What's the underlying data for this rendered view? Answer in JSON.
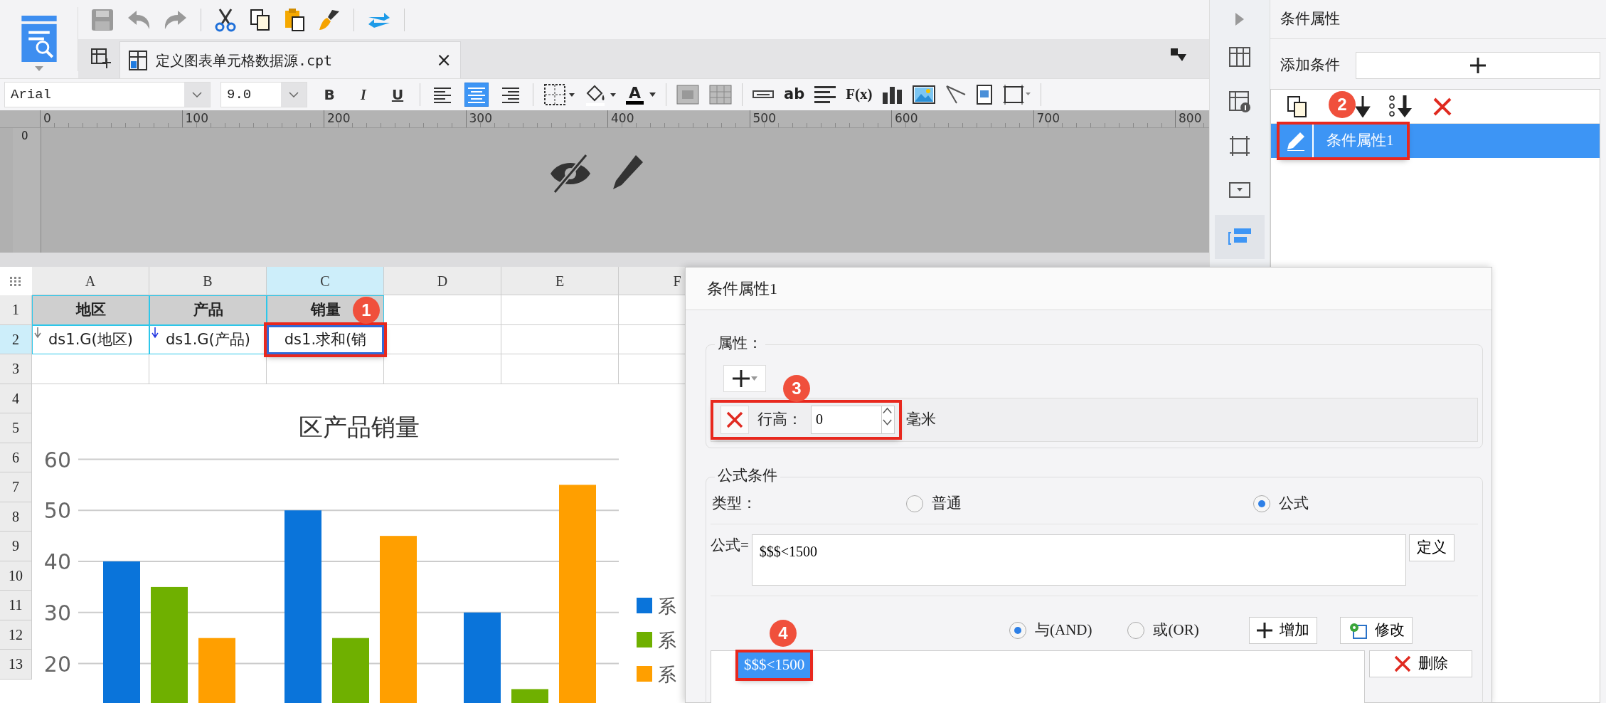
{
  "toolbar": {
    "tab": {
      "title": "定义图表单元格数据源.cpt",
      "close": "×"
    }
  },
  "format_bar": {
    "font": "Arial",
    "font_size": "9.0",
    "style_buttons": [
      "B",
      "I",
      "U"
    ],
    "align_buttons": [
      {
        "kind": "left",
        "selected": false
      },
      {
        "kind": "center",
        "selected": true
      },
      {
        "kind": "right",
        "selected": false
      }
    ],
    "font_color_label": "A",
    "text_field_label": "ab",
    "formula_label": "F(x)"
  },
  "ruler": {
    "ticks": [
      "0",
      "100",
      "200",
      "300",
      "400",
      "500",
      "600",
      "700",
      "800"
    ],
    "vertical_tick": "0"
  },
  "sheet": {
    "columns": [
      {
        "label": "A",
        "selected": false
      },
      {
        "label": "B",
        "selected": false
      },
      {
        "label": "C",
        "selected": true
      },
      {
        "label": "D",
        "selected": false
      },
      {
        "label": "E",
        "selected": false
      },
      {
        "label": "F",
        "selected": false
      }
    ],
    "rows": [
      {
        "number": "1",
        "selected": false,
        "cells": [
          {
            "text": "地区",
            "kind": "header",
            "outlined": false
          },
          {
            "text": "产品",
            "kind": "header",
            "outlined": false
          },
          {
            "text": "销量",
            "kind": "header",
            "outlined": false
          }
        ]
      },
      {
        "number": "2",
        "selected": true,
        "cells": [
          {
            "text": "ds1.G(地区)",
            "kind": "group",
            "outlined": false
          },
          {
            "text": "ds1.G(产品)",
            "kind": "group",
            "outlined": false
          },
          {
            "text": "ds1.求和(销",
            "kind": "sum",
            "outlined": true
          }
        ]
      },
      {
        "number": "3",
        "selected": false
      },
      {
        "number": "4",
        "selected": false
      },
      {
        "number": "5",
        "selected": false
      },
      {
        "number": "6",
        "selected": false
      },
      {
        "number": "7",
        "selected": false
      },
      {
        "number": "8",
        "selected": false
      },
      {
        "number": "9",
        "selected": false
      },
      {
        "number": "10",
        "selected": false
      },
      {
        "number": "11",
        "selected": false
      },
      {
        "number": "12",
        "selected": false
      },
      {
        "number": "13",
        "selected": false
      }
    ],
    "chart": {
      "chart_data": {
        "type": "bar",
        "title": "区产品销量",
        "yticks": [
          20,
          30,
          40,
          50,
          60
        ],
        "ylim": [
          12,
          60
        ],
        "grid": true,
        "series": [
          {
            "name": "系",
            "color": "#0a74da",
            "values": [
              40,
              50,
              30
            ]
          },
          {
            "name": "系",
            "color": "#6fb000",
            "values": [
              35,
              25,
              15
            ]
          },
          {
            "name": "系",
            "color": "#ff9f00",
            "values": [
              25,
              45,
              55
            ]
          }
        ]
      }
    }
  },
  "side_strip": {
    "items": [
      {
        "kind": "grid",
        "selected": false
      },
      {
        "kind": "info",
        "selected": false
      },
      {
        "kind": "frame",
        "selected": false
      },
      {
        "kind": "dropdown",
        "selected": false
      },
      {
        "kind": "condition",
        "selected": true
      }
    ]
  },
  "panel": {
    "title": "条件属性",
    "add_label": "添加条件",
    "conditions": [
      {
        "label": "条件属性1",
        "selected": true,
        "outlined": true
      }
    ]
  },
  "dialog": {
    "title": "条件属性1",
    "properties_legend": "属性：",
    "properties": [
      {
        "label": "行高：",
        "value": "0",
        "unit": "毫米",
        "outlined": true
      }
    ],
    "formula_legend": "公式条件",
    "type_label": "类型：",
    "types": [
      {
        "label": "普通",
        "selected": false
      },
      {
        "label": "公式",
        "selected": true
      }
    ],
    "formula_label": "公式=",
    "formula": "$$$<1500",
    "define_button": "定义",
    "logic": [
      {
        "label": "与(AND)",
        "selected": true
      },
      {
        "label": "或(OR)",
        "selected": false
      }
    ],
    "add_button": "增加",
    "modify_button": "修改",
    "delete_button": "删除",
    "conditions": [
      {
        "label": "$$$<1500",
        "selected": true,
        "outlined": true
      }
    ]
  },
  "callouts": [
    {
      "number": "1"
    },
    {
      "number": "2"
    },
    {
      "number": "3"
    },
    {
      "number": "4"
    }
  ]
}
